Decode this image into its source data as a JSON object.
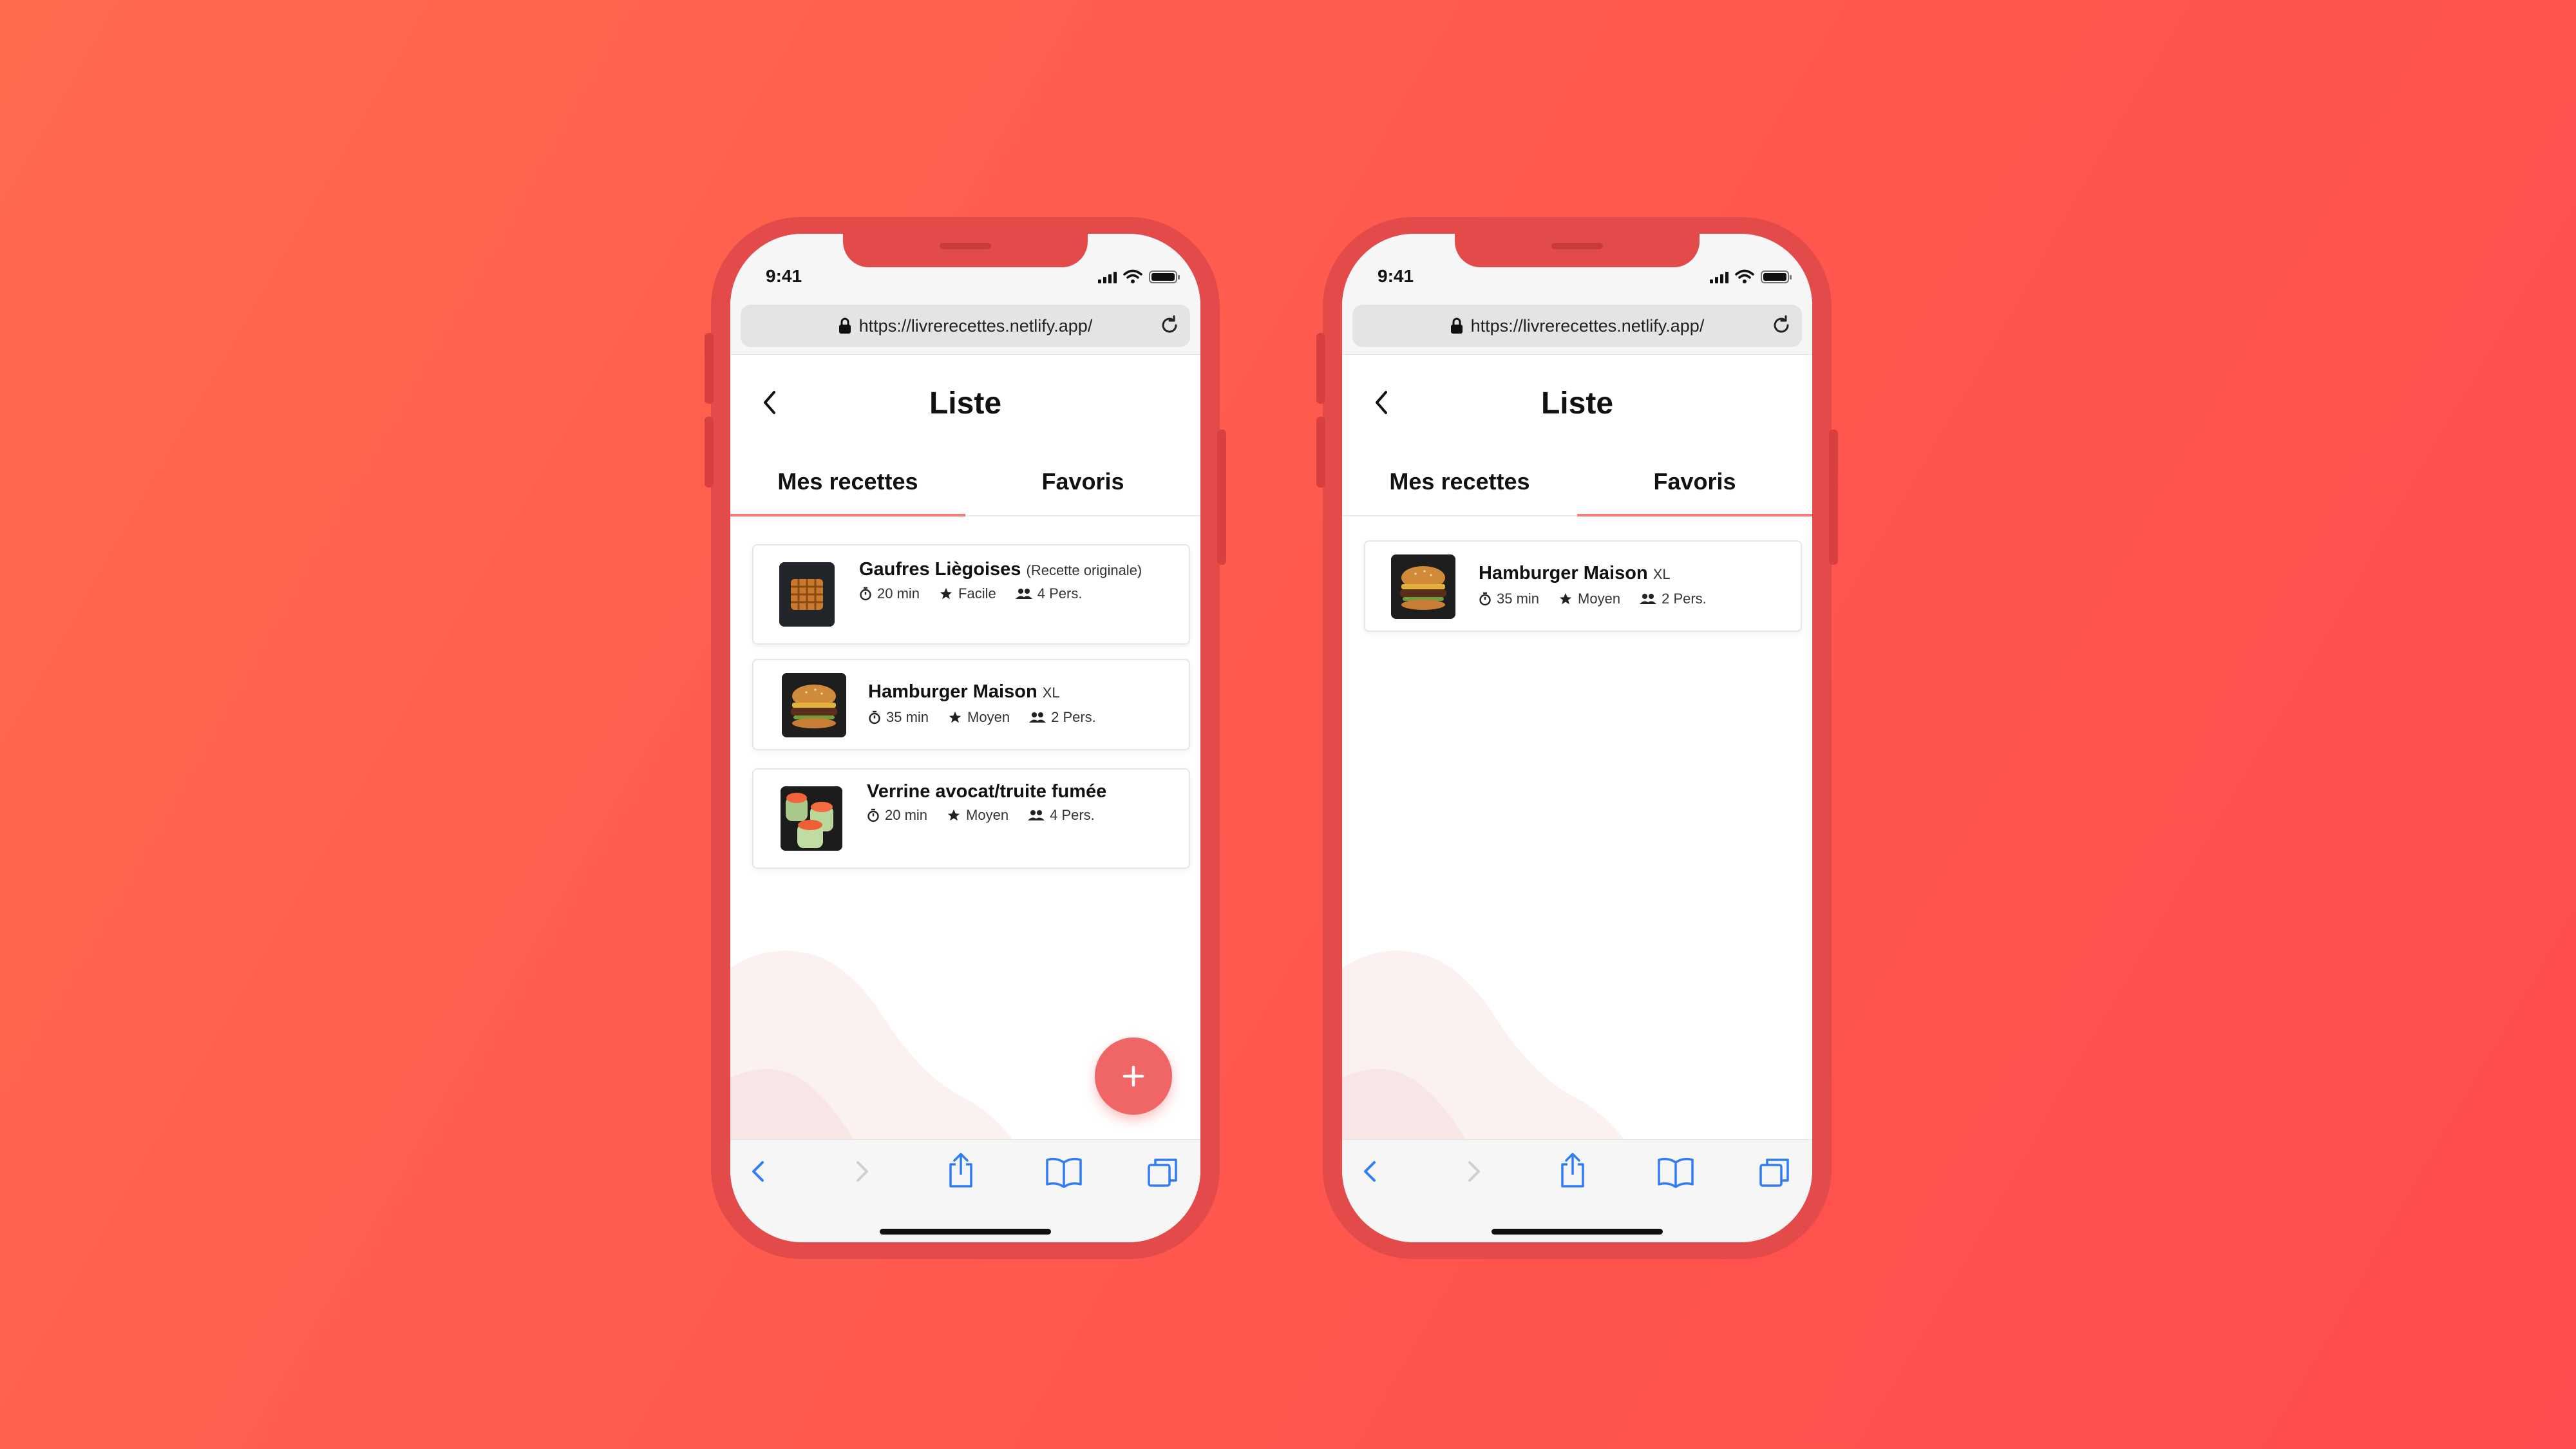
{
  "colors": {
    "background_start": "#ff6a4d",
    "background_end": "#ff4b4f",
    "phone_frame": "#e34a4a",
    "accent": "#f06565",
    "link_blue": "#2f7cf6"
  },
  "phones": [
    {
      "status_bar": {
        "time": "9:41"
      },
      "browser": {
        "url": "https://livrerecettes.netlify.app/"
      },
      "header": {
        "title": "Liste"
      },
      "tabs": [
        {
          "label": "Mes recettes",
          "active": true
        },
        {
          "label": "Favoris",
          "active": false
        }
      ],
      "recipes": [
        {
          "title": "Gaufres Liègoises",
          "subtitle": "(Recette originale)",
          "time": "20 min",
          "difficulty": "Facile",
          "servings": "4 Pers.",
          "image": "waffle-photo"
        },
        {
          "title": "Hamburger Maison",
          "subtitle": "XL",
          "time": "35 min",
          "difficulty": "Moyen",
          "servings": "2 Pers.",
          "image": "burger-photo"
        },
        {
          "title": "Verrine avocat/truite fumée",
          "subtitle": "",
          "time": "20 min",
          "difficulty": "Moyen",
          "servings": "4 Pers.",
          "image": "verrine-photo"
        }
      ],
      "fab": {
        "icon": "plus-icon"
      }
    },
    {
      "status_bar": {
        "time": "9:41"
      },
      "browser": {
        "url": "https://livrerecettes.netlify.app/"
      },
      "header": {
        "title": "Liste"
      },
      "tabs": [
        {
          "label": "Mes recettes",
          "active": false
        },
        {
          "label": "Favoris",
          "active": true
        }
      ],
      "recipes": [
        {
          "title": "Hamburger Maison",
          "subtitle": "XL",
          "time": "35 min",
          "difficulty": "Moyen",
          "servings": "2 Pers.",
          "image": "burger-photo"
        }
      ]
    }
  ]
}
